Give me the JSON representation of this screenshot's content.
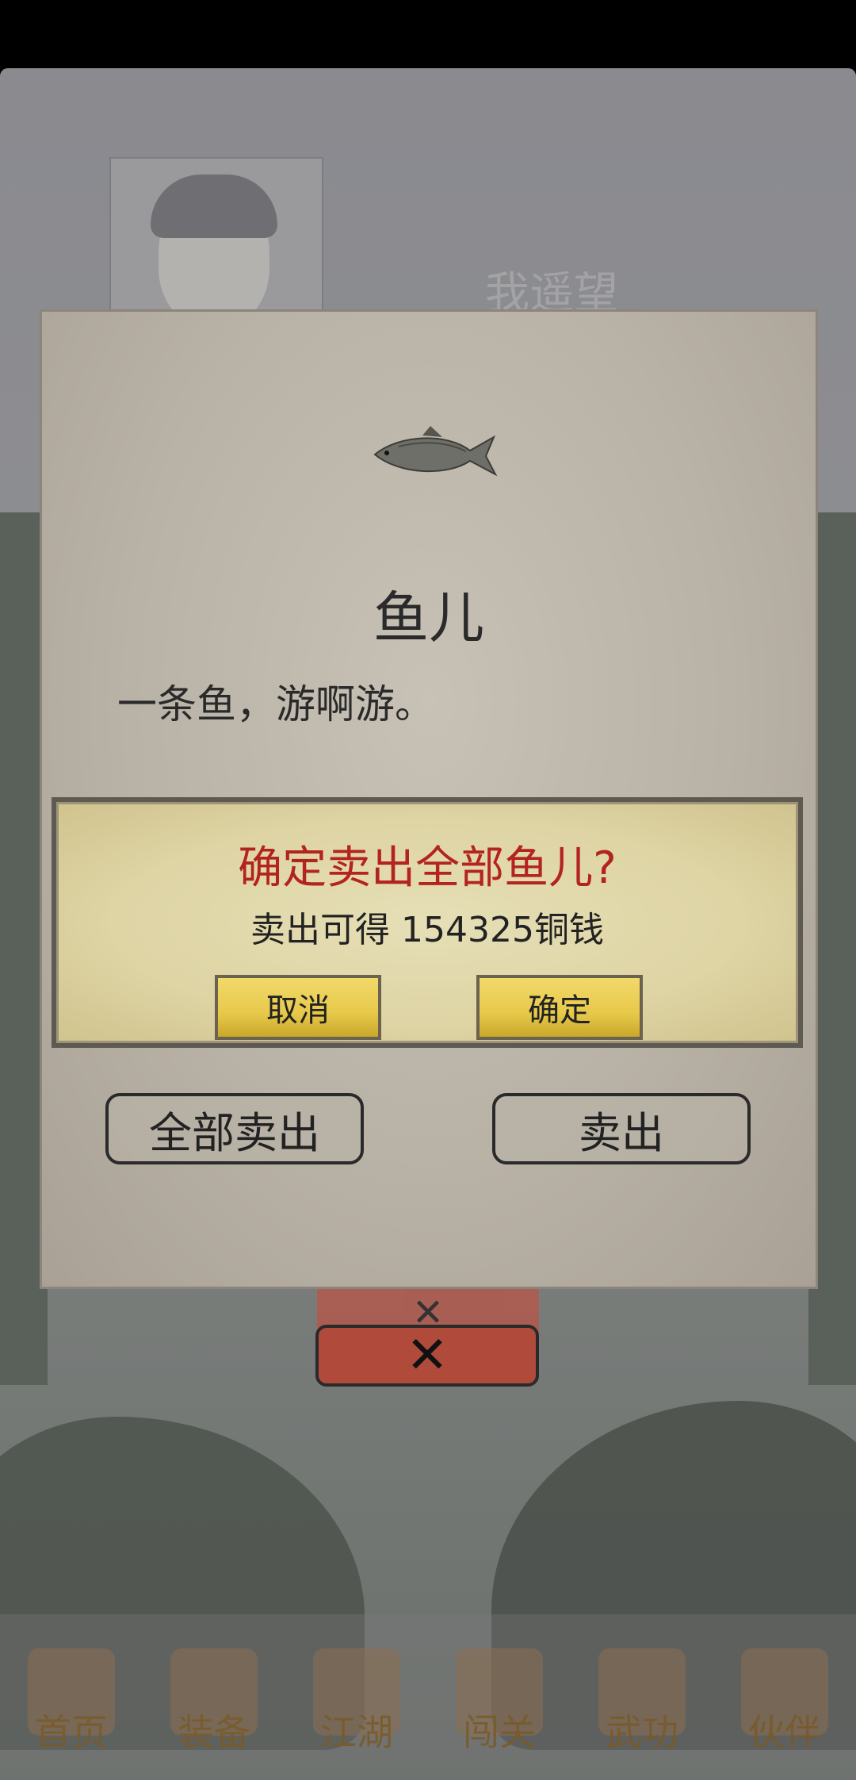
{
  "background": {
    "player_name": "我遥望"
  },
  "item_dialog": {
    "item_name": "鱼儿",
    "item_description": "一条鱼，游啊游。",
    "sell_all_label": "全部卖出",
    "sell_label": "卖出"
  },
  "confirm_dialog": {
    "title": "确定卖出全部鱼儿?",
    "message": "卖出可得 154325铜钱",
    "cancel_label": "取消",
    "ok_label": "确定"
  },
  "close_button": {
    "label": "✕"
  },
  "bottom_nav": {
    "items": [
      {
        "label": "首页"
      },
      {
        "label": "装备"
      },
      {
        "label": "江湖"
      },
      {
        "label": "闯关"
      },
      {
        "label": "武功"
      },
      {
        "label": "伙伴"
      }
    ]
  },
  "colors": {
    "confirm_title": "#b3241f",
    "button_gold": "#e7c94a",
    "close_red": "#b04b3c"
  }
}
